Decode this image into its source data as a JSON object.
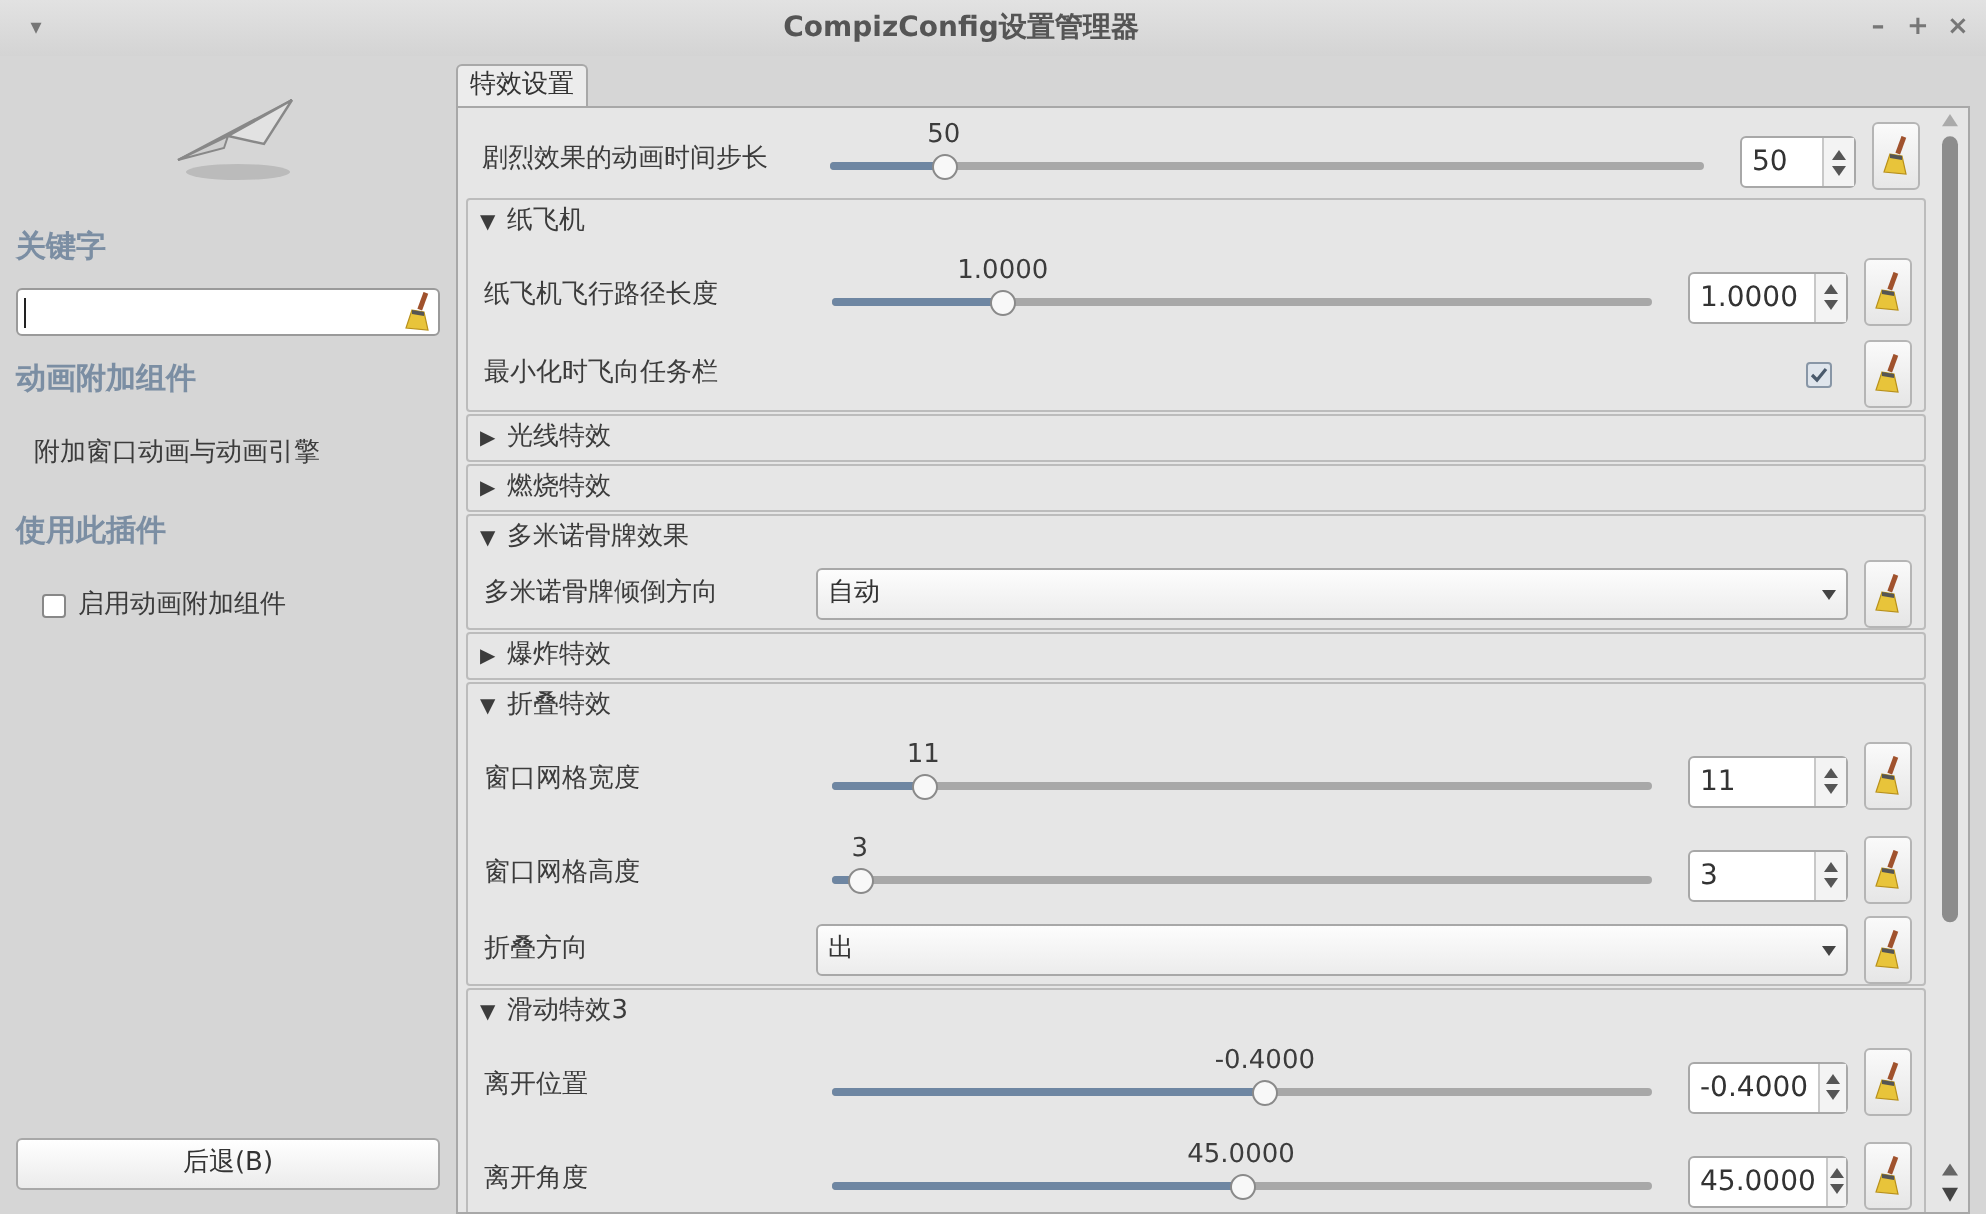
{
  "window": {
    "title": "CompizConfig设置管理器",
    "menu_glyph": "▾",
    "controls": [
      "–",
      "+",
      "×"
    ]
  },
  "sidebar": {
    "sections": [
      {
        "heading": "关键字",
        "kind": "search"
      },
      {
        "heading": "动画附加组件",
        "kind": "text",
        "text": "附加窗口动画与动画引擎"
      },
      {
        "heading": "使用此插件",
        "kind": "checkbox",
        "label": "启用动画附加组件",
        "checked": false
      }
    ],
    "back_button": "后退(B)"
  },
  "tabs": [
    {
      "label": "特效设置",
      "selected": true
    }
  ],
  "items": [
    {
      "kind": "slider",
      "label": "剧烈效果的动画时间步长",
      "reading": "50",
      "value": "50",
      "level": 0.12
    },
    {
      "kind": "group",
      "title": "纸飞机",
      "expanded": true,
      "children": [
        {
          "kind": "slider",
          "label": "纸飞机飞行路径长度",
          "reading": "1.0000",
          "value": "1.0000",
          "level": 0.2
        },
        {
          "kind": "checkbox",
          "label": "最小化时飞向任务栏",
          "checked": true
        }
      ]
    },
    {
      "kind": "group",
      "title": "光线特效",
      "expanded": false
    },
    {
      "kind": "group",
      "title": "燃烧特效",
      "expanded": false
    },
    {
      "kind": "group",
      "title": "多米诺骨牌效果",
      "expanded": true,
      "children": [
        {
          "kind": "select",
          "label": "多米诺骨牌倾倒方向",
          "value": "自动"
        }
      ]
    },
    {
      "kind": "group",
      "title": "爆炸特效",
      "expanded": false
    },
    {
      "kind": "group",
      "title": "折叠特效",
      "expanded": true,
      "children": [
        {
          "kind": "slider",
          "label": "窗口网格宽度",
          "reading": "11",
          "value": "11",
          "level": 0.1
        },
        {
          "kind": "slider",
          "label": "窗口网格高度",
          "reading": "3",
          "value": "3",
          "level": 0.02
        },
        {
          "kind": "select",
          "label": "折叠方向",
          "value": "出"
        }
      ]
    },
    {
      "kind": "group",
      "title": "滑动特效3",
      "expanded": true,
      "children": [
        {
          "kind": "slider",
          "label": "离开位置",
          "reading": "-0.4000",
          "value": "-0.4000",
          "level": 0.53
        },
        {
          "kind": "slider",
          "label": "离开角度",
          "reading": "45.0000",
          "value": "45.0000",
          "level": 0.5
        }
      ]
    }
  ],
  "expander_glyphs": {
    "expanded": "▼",
    "collapsed": "▶"
  }
}
